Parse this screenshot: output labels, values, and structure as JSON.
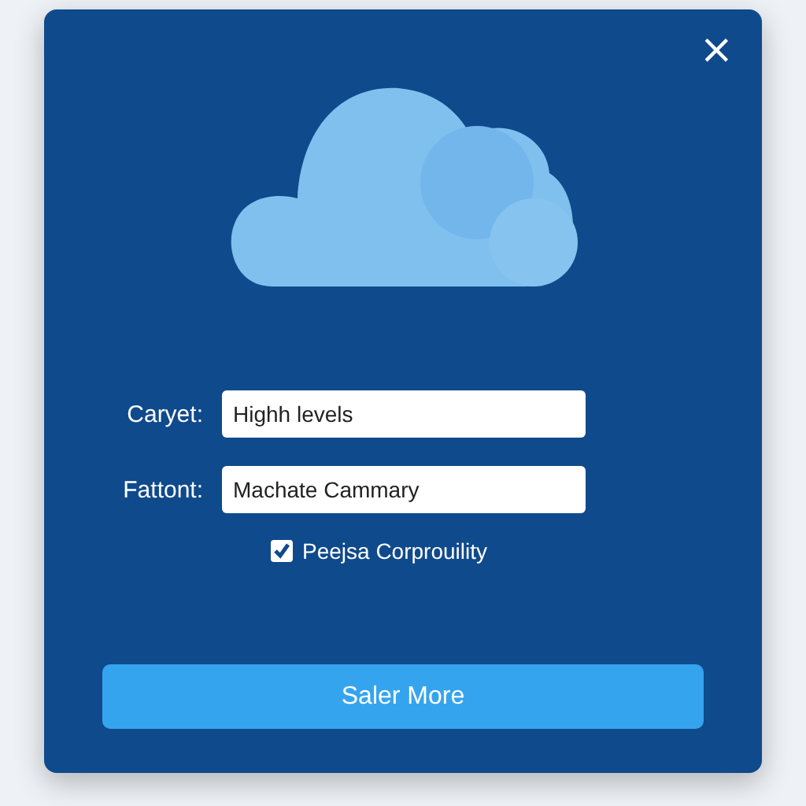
{
  "close_button": {
    "label": "×"
  },
  "fields": [
    {
      "label": "Caryet:",
      "value": "Highh levels"
    },
    {
      "label": "Fattont:",
      "value": "Machate Cammary"
    }
  ],
  "checkbox": {
    "label": "Peejsa Corprouility",
    "checked": true
  },
  "button": {
    "label": "Saler More"
  }
}
